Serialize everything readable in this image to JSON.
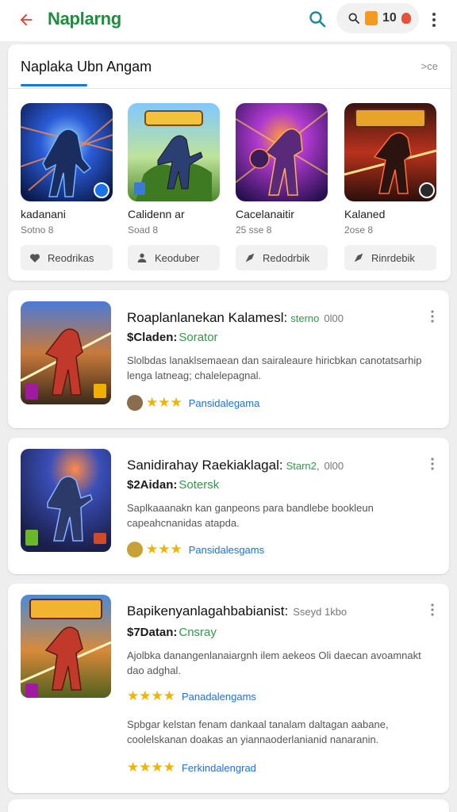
{
  "topbar": {
    "title": "Naplarng",
    "pill_count": "10"
  },
  "featured": {
    "header": "Naplaka Ubn Angam",
    "more": ">ce",
    "games": [
      {
        "name": "kadanani",
        "sub": "Sotno 8",
        "action": "Reodrikas",
        "icon": "heart-icon"
      },
      {
        "name": "Calidenn ar",
        "sub": "Soad 8",
        "action": "Keoduber",
        "icon": "person-icon"
      },
      {
        "name": "Cacelanaitir",
        "sub": "25 sse 8",
        "action": "Redodrbik",
        "icon": "share-icon"
      },
      {
        "name": "Kalaned",
        "sub": "2ose 8",
        "action": "Rinrdebik",
        "icon": "share-icon"
      }
    ]
  },
  "list": [
    {
      "title": "Roaplanlanekan Kalamesl:",
      "tag": "sterno",
      "tag2": "0l00",
      "price": "$Claden:",
      "sale": "Sorator",
      "desc": "Slolbdas lanaklsemaean dan sairaleaure hiricbkan canotatsarhip lenga latneag; chalelepagnal.",
      "stars": "★★★",
      "rating_label": "Pansidalegama"
    },
    {
      "title": "Sanidirahay Raekiaklagal:",
      "tag": "Starn2,",
      "tag2": "0l00",
      "price": "$2Aidan:",
      "sale": "Sotersk",
      "desc": "Saplkaaanakn kan ganpeons para bandlebe bookleun capeahcnanidas atapda.",
      "stars": "★★★",
      "rating_label": "Pansidalesgams"
    },
    {
      "title": "Bapikenyanlagahbabianist:",
      "tag": "",
      "tag2": "Sseyd 1kbo",
      "price": "$7Datan:",
      "sale": "Cnsray",
      "desc": "Ajolbka danangenlanaiargnh ilem aekeos Oli daecan avoamnakt dao adghal.",
      "stars": "★★★★",
      "rating_label": "Panadalengams",
      "extra_desc": "Spbgar kelstan fenam dankaal tanalam daltagan aabane, coolelskanan doakas an yiannaoderlanianid nanaranin.",
      "extra_stars": "★★★★",
      "extra_rating_label": "Ferkindalengrad"
    }
  ],
  "colors": {
    "brand_green": "#1e8e3e",
    "accent_blue": "#1a73e8",
    "star_gold": "#f0b400",
    "back_red": "#e53935"
  }
}
